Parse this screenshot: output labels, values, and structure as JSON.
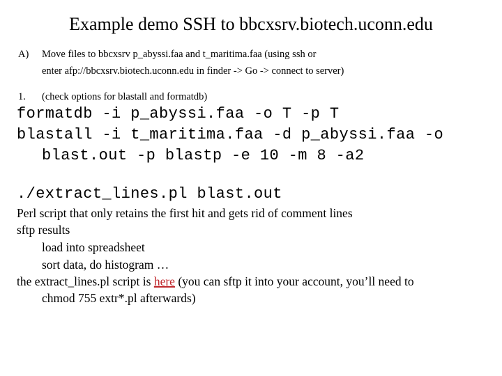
{
  "title": "Example demo SSH to bbcxsrv.biotech.uconn.edu",
  "step_a": {
    "marker": "A)",
    "line1": "Move files to bbcxsrv p_abyssi.faa and t_maritima.faa   (using ssh or",
    "line2": "enter afp://bbcxsrv.biotech.uconn.edu in finder -> Go -> connect to server)"
  },
  "step_1": {
    "marker": "1.",
    "text": "(check options for blastall and formatdb)"
  },
  "commands": {
    "formatdb": "formatdb -i p_abyssi.faa -o T -p T",
    "blastall_line1": "blastall -i t_maritima.faa -d p_abyssi.faa -o",
    "blastall_line2": "blast.out -p blastp -e 10 -m 8 -a2",
    "extract": "./extract_lines.pl blast.out"
  },
  "notes": {
    "perl": "Perl script that only retains the first hit and gets rid of comment lines",
    "sftp": "sftp results",
    "load": "load into spreadsheet",
    "sort": "sort data, do histogram …",
    "script_prefix": "the extract_lines.pl script is ",
    "script_link": "here",
    "script_suffix": " (you can sftp it into your account, you’ll need to",
    "chmod": "chmod 755 extr*.pl afterwards)"
  },
  "colors": {
    "link": "#c0282d"
  }
}
